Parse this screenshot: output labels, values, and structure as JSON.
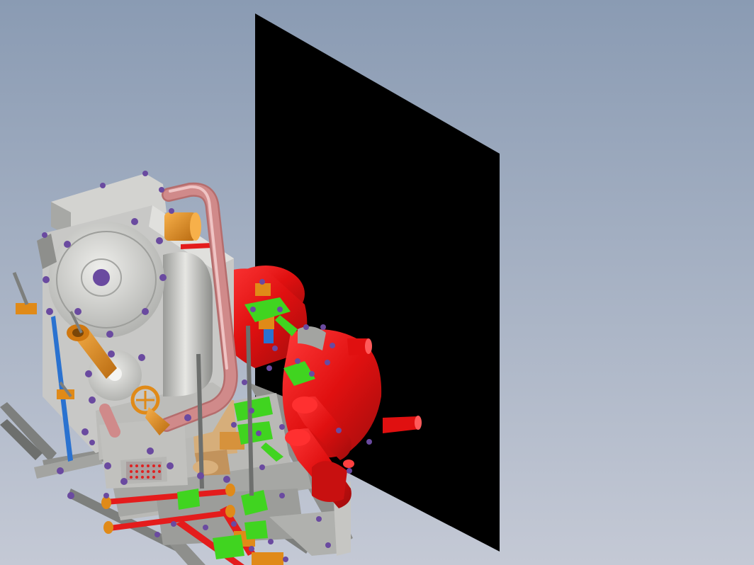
{
  "viewport": {
    "background_top": "#8a9bb3",
    "background_bottom": "#c4c9d5"
  },
  "colors": {
    "panel": "#000000",
    "housing": "#c8c8c6",
    "housing_dark": "#8e8f8c",
    "housing_light": "#e2e2df",
    "pipe": "#d08a8a",
    "pipe_highlight": "#efc4c4",
    "valve_body": "#e01010",
    "valve_dark": "#9a0c0c",
    "fitting": "#e08a18",
    "fitting_dark": "#9c5a0e",
    "bracket": "#40d420",
    "bolt": "#6a4aa0",
    "rod_red": "#e41c1c",
    "rod_blue": "#2a72d0",
    "strut": "#7d7f7d",
    "brass": "#cfa068"
  }
}
